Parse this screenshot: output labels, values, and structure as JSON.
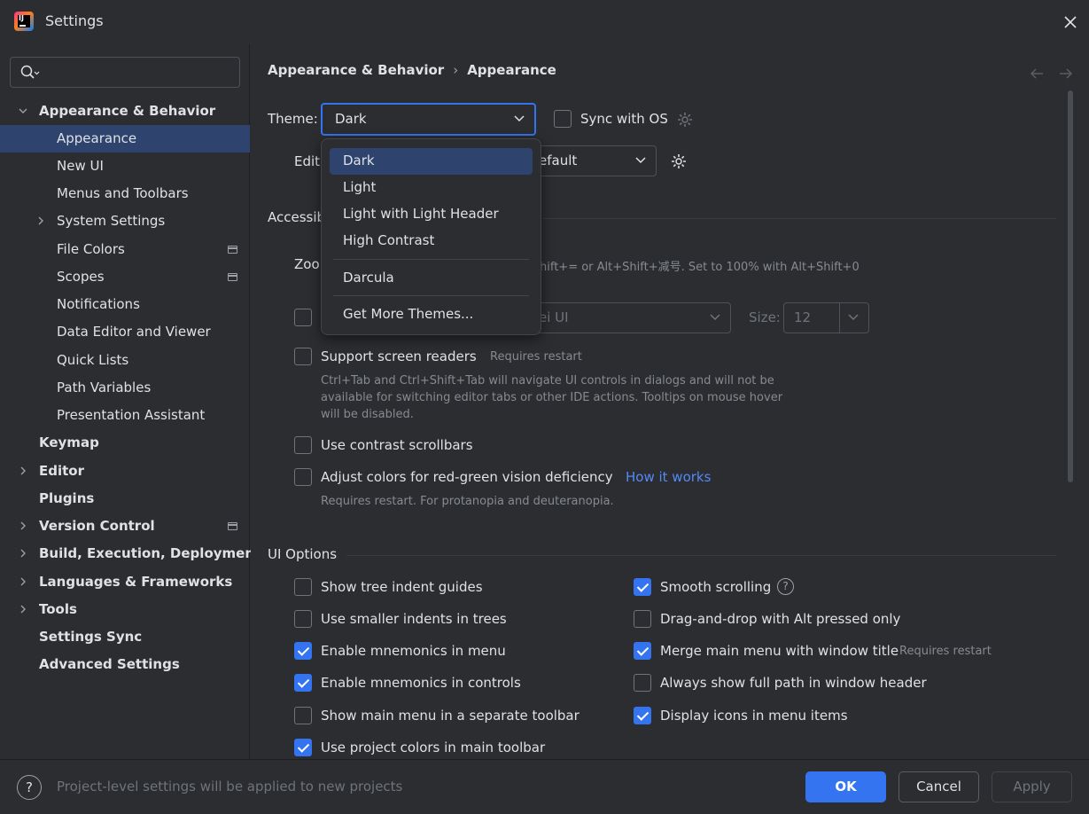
{
  "window": {
    "title": "Settings"
  },
  "search": {
    "placeholder": ""
  },
  "sidebar": {
    "items": [
      {
        "label": "Appearance & Behavior",
        "expanded": true
      },
      {
        "label": "Appearance",
        "selected": true
      },
      {
        "label": "New UI"
      },
      {
        "label": "Menus and Toolbars"
      },
      {
        "label": "System Settings",
        "expandable": true
      },
      {
        "label": "File Colors"
      },
      {
        "label": "Scopes"
      },
      {
        "label": "Notifications"
      },
      {
        "label": "Data Editor and Viewer"
      },
      {
        "label": "Quick Lists"
      },
      {
        "label": "Path Variables"
      },
      {
        "label": "Presentation Assistant"
      },
      {
        "label": "Keymap"
      },
      {
        "label": "Editor",
        "expandable": true
      },
      {
        "label": "Plugins"
      },
      {
        "label": "Version Control",
        "expandable": true
      },
      {
        "label": "Build, Execution, Deployment",
        "expandable": true
      },
      {
        "label": "Languages & Frameworks",
        "expandable": true
      },
      {
        "label": "Tools",
        "expandable": true
      },
      {
        "label": "Settings Sync"
      },
      {
        "label": "Advanced Settings"
      }
    ]
  },
  "breadcrumb": {
    "parent": "Appearance & Behavior",
    "separator": "›",
    "current": "Appearance"
  },
  "theme": {
    "label": "Theme:",
    "value": "Dark",
    "sync_label": "Sync with OS",
    "sync_checked": false
  },
  "editor_scheme": {
    "label_fragment": "Edit",
    "value_fragment": "efault"
  },
  "theme_popup": {
    "items": [
      "Dark",
      "Light",
      "Light with Light Header",
      "High Contrast",
      "Darcula",
      "Get More Themes..."
    ],
    "selected": "Dark"
  },
  "accessibility": {
    "title_fragment": "Accessib",
    "zoom_label_fragment": "Zoo",
    "zoom_hint_fragment": "hift+= or Alt+Shift+减号. Set to 100% with Alt+Shift+0",
    "font_value_fragment": "ei UI",
    "size_label": "Size:",
    "size_value": "12",
    "screen_readers_label": "Support screen readers",
    "screen_readers_note": "Requires restart",
    "screen_readers_hint": "Ctrl+Tab and Ctrl+Shift+Tab will navigate UI controls in dialogs and will not be available for switching editor tabs or other IDE actions. Tooltips on mouse hover will be disabled.",
    "contrast_scrollbars_label": "Use contrast scrollbars",
    "color_deficiency_label": "Adjust colors for red-green vision deficiency",
    "how_it_works": "How it works",
    "color_deficiency_hint": "Requires restart. For protanopia and deuteranopia."
  },
  "ui_options": {
    "title": "UI Options",
    "left": [
      {
        "label": "Show tree indent guides",
        "checked": false
      },
      {
        "label": "Use smaller indents in trees",
        "checked": false
      },
      {
        "label": "Enable mnemonics in menu",
        "checked": true
      },
      {
        "label": "Enable mnemonics in controls",
        "checked": true
      },
      {
        "label": "Show main menu in a separate toolbar",
        "checked": false
      },
      {
        "label": "Use project colors in main toolbar",
        "checked": true
      }
    ],
    "right": [
      {
        "label": "Smooth scrolling",
        "checked": true
      },
      {
        "label": "Drag-and-drop with Alt pressed only",
        "checked": false
      },
      {
        "label": "Merge main menu with window title",
        "checked": true,
        "note": "Requires restart"
      },
      {
        "label": "Always show full path in window header",
        "checked": false
      },
      {
        "label": "Display icons in menu items",
        "checked": true
      }
    ],
    "help_glyph": "?"
  },
  "footer": {
    "help_glyph": "?",
    "note": "Project-level settings will be applied to new projects",
    "ok": "OK",
    "cancel": "Cancel",
    "apply": "Apply"
  },
  "colors": {
    "accent": "#3574f0",
    "selection": "#2e436e",
    "background": "#2b2d30",
    "link": "#548af7"
  }
}
